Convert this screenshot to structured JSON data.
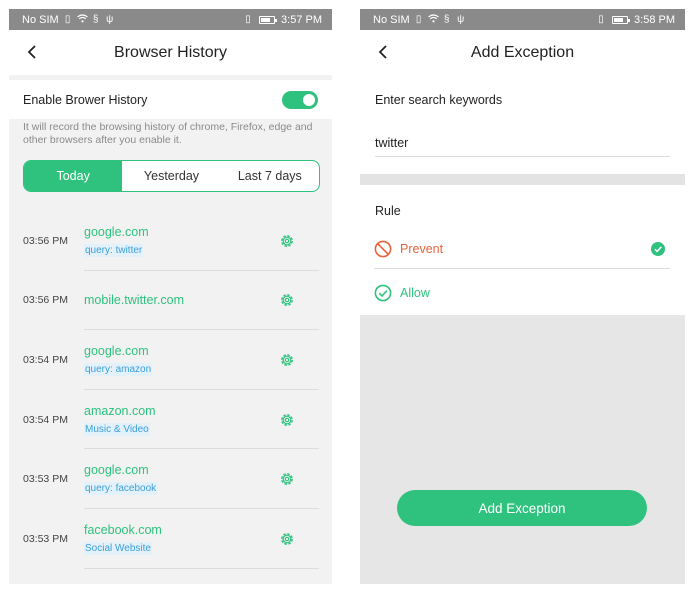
{
  "left_screen": {
    "status_bar": {
      "carrier": "No SIM",
      "time": "3:57 PM"
    },
    "title": "Browser History",
    "enable_label": "Enable Brower History",
    "toggle_on": true,
    "note": "It will record the browsing history of chrome, Firefox, edge and other browsers after you enable it.",
    "tabs": [
      {
        "label": "Today",
        "active": true
      },
      {
        "label": "Yesterday",
        "active": false
      },
      {
        "label": "Last 7 days",
        "active": false
      }
    ],
    "history": [
      {
        "time": "03:56 PM",
        "domain": "google.com",
        "tag": "query: twitter"
      },
      {
        "time": "03:56 PM",
        "domain": "mobile.twitter.com",
        "tag": ""
      },
      {
        "time": "03:54 PM",
        "domain": "google.com",
        "tag": "query: amazon"
      },
      {
        "time": "03:54 PM",
        "domain": "amazon.com",
        "tag": "Music & Video"
      },
      {
        "time": "03:53 PM",
        "domain": "google.com",
        "tag": "query: facebook"
      },
      {
        "time": "03:53 PM",
        "domain": "facebook.com",
        "tag": "Social Website"
      }
    ]
  },
  "right_screen": {
    "status_bar": {
      "carrier": "No SIM",
      "time": "3:58 PM"
    },
    "title": "Add Exception",
    "keyword_label": "Enter search keywords",
    "keyword_value": "twitter",
    "rule_label": "Rule",
    "rules": [
      {
        "label": "Prevent",
        "selected": true
      },
      {
        "label": "Allow",
        "selected": false
      }
    ],
    "button_label": "Add Exception"
  },
  "colors": {
    "accent_green": "#2ec27e",
    "prevent_red": "#e8643c",
    "tag_blue": "#3b9fd8",
    "status_bar_gray": "#8a8a8a"
  },
  "icons": [
    "back-arrow-icon",
    "wifi-icon",
    "sim-icon",
    "usb-icon",
    "vibrate-icon",
    "battery-icon",
    "gear-icon",
    "prevent-icon",
    "allow-check-icon",
    "selected-check-icon"
  ]
}
